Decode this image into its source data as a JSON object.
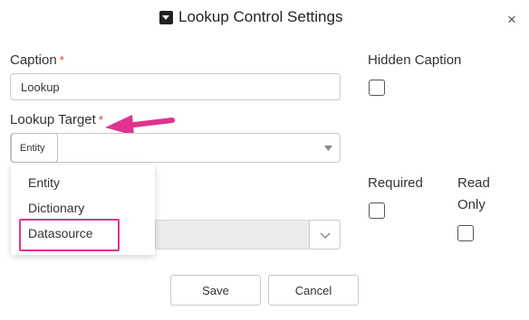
{
  "dialog": {
    "title": "Lookup Control Settings",
    "title_icon": "dropdown-box-icon",
    "close_icon": "close-icon",
    "close_label": "×"
  },
  "caption": {
    "label": "Caption",
    "required_mark": "*",
    "value": "Lookup"
  },
  "hidden_caption": {
    "label": "Hidden Caption",
    "checked": false
  },
  "lookup_target": {
    "label": "Lookup Target",
    "required_mark": "*",
    "type_value": "Entity",
    "dropdown_options": [
      "Entity",
      "Dictionary",
      "Datasource"
    ],
    "highlighted_option": "Datasource"
  },
  "required": {
    "label": "Required",
    "checked": false
  },
  "read_only": {
    "label_line1": "Read",
    "label_line2": "Only",
    "checked": false
  },
  "buttons": {
    "save": "Save",
    "cancel": "Cancel"
  },
  "annotation": {
    "arrow_color": "#e0338f",
    "highlight_color": "#e0338f"
  }
}
